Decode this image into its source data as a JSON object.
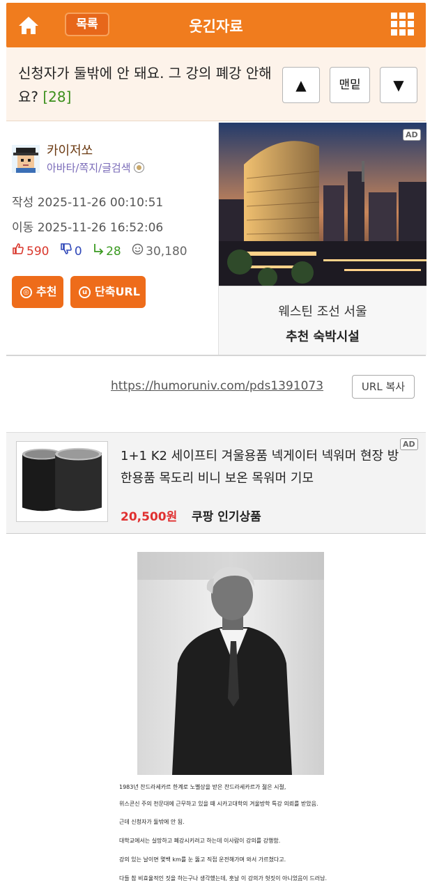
{
  "header": {
    "list_label": "목록",
    "site_title": "웃긴자료"
  },
  "post": {
    "title": "신청자가 둘밖에 안 돼요. 그 강의 폐강 안해요?",
    "comment_count": "[28]",
    "nav": {
      "up": "▲",
      "bottom": "맨밑",
      "down": "▼"
    }
  },
  "author": {
    "name": "카이저쏘",
    "links": "아바타/쪽지/글검색",
    "written_label": "작성",
    "written": "2025-11-26 00:10:51",
    "moved_label": "이동",
    "moved": "2025-11-26 16:52:06",
    "upvotes": "590",
    "downvotes": "0",
    "replies": "28",
    "views": "30,180",
    "recommend_label": "추천",
    "shorturl_label": "단축URL"
  },
  "hotel_ad": {
    "badge": "AD",
    "name": "웨스틴 조선 서울",
    "category": "추천 숙박시설"
  },
  "share": {
    "url": "https://humoruniv.com/pds1391073",
    "copy_label": "URL 복사"
  },
  "product_ad": {
    "badge": "AD",
    "title": "1+1 K2 세이프티 겨울용품 넥게이터 넥워머 현장 방한용품 목도리 비니 보온 목워머 기모",
    "price": "20,500원",
    "store": "쿠팡 인기상품"
  },
  "content": {
    "captions": [
      "1983년 찬드라세카르 한계로 노벨상을 받은 찬드라세카르가 젊은 시절,",
      "위스콘신 주의 천문대에 근무하고 있을 때 시카고대학의 겨울방학 특강 의뢰를 받았음.",
      "근데 신청자가 둘밖에 안 됨.",
      "대학교에서는 실망하고 폐강시키려고 하는데 이사람이 강의를 강행함.",
      "강의 있는 날이면 몇백 km를 눈 뚫고 직접 운전해가며 와서 가르쳤다고.",
      "다들 참 비효율적인 짓을 하는구나 생각했는데, 훗날 이 강의가 헛짓이 아니었음이 드러남."
    ]
  },
  "colors": {
    "brand_orange": "#f07c1e",
    "title_bg": "#fdf3ea",
    "comment_count_green": "#3b8f1c",
    "price_red": "#e03030"
  },
  "icons": {
    "home": "home-icon",
    "menu": "grid-menu-icon",
    "thumbs_up": "thumbs-up-icon",
    "thumbs_down": "thumbs-down-icon",
    "reply": "reply-icon",
    "views": "smile-icon"
  }
}
